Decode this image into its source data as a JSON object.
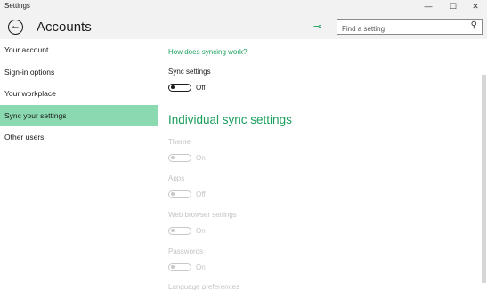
{
  "window": {
    "title": "Settings",
    "controls": {
      "minimize": "—",
      "maximize": "☐",
      "close": "✕"
    }
  },
  "header": {
    "back_icon": "←",
    "title": "Accounts",
    "pin_icon": "⊸",
    "search": {
      "placeholder": "Find a setting",
      "icon": "⚲"
    }
  },
  "sidebar": {
    "items": [
      {
        "label": "Your account"
      },
      {
        "label": "Sign-in options"
      },
      {
        "label": "Your workplace"
      },
      {
        "label": "Sync your settings",
        "selected": true
      },
      {
        "label": "Other users"
      }
    ]
  },
  "content": {
    "help_link": "How does syncing work?",
    "sync_settings": {
      "label": "Sync settings",
      "state": "Off",
      "enabled": true
    },
    "section_heading": "Individual sync settings",
    "items": [
      {
        "label": "Theme",
        "state": "On",
        "enabled": false
      },
      {
        "label": "Apps",
        "state": "Off",
        "enabled": false
      },
      {
        "label": "Web browser settings",
        "state": "On",
        "enabled": false
      },
      {
        "label": "Passwords",
        "state": "On",
        "enabled": false
      },
      {
        "label": "Language preferences",
        "enabled": false
      }
    ]
  },
  "colors": {
    "accent": "#1a9e5c",
    "selected_bg": "#8bd9b0",
    "chrome_bg": "#f2f2f2",
    "disabled": "#c4c4c4"
  }
}
